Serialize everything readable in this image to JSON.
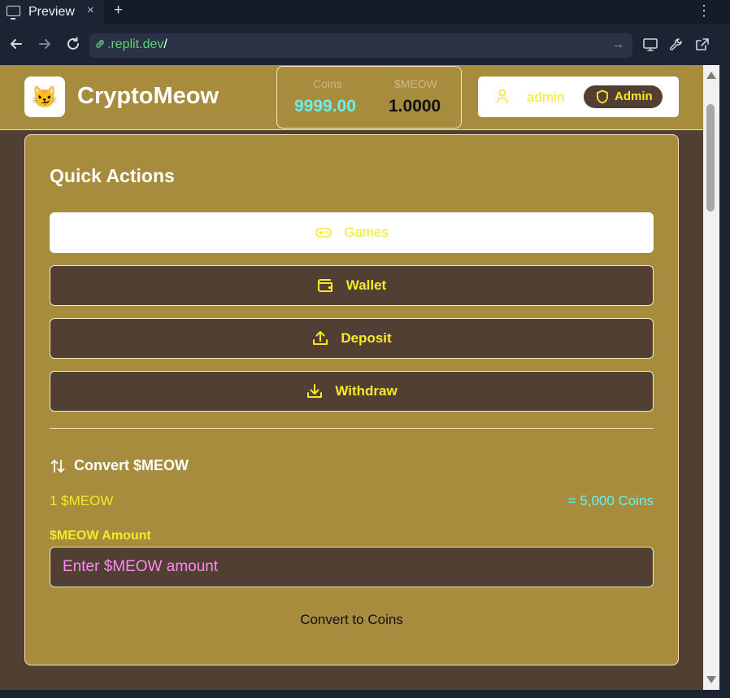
{
  "browser": {
    "tab_title": "Preview",
    "tab_close": "×",
    "new_tab": "+",
    "menu": "⋮",
    "url_host": ".replit.dev",
    "url_path": "/"
  },
  "header": {
    "logo_emoji": "😼",
    "brand": "CryptoMeow",
    "balances": {
      "coins_label": "Coins",
      "coins_value": "9999.00",
      "meow_label": "$MEOW",
      "meow_value": "1.0000"
    },
    "user": {
      "name": "admin",
      "badge": "Admin"
    }
  },
  "quick_actions": {
    "title": "Quick Actions",
    "buttons": [
      {
        "label": "Games",
        "icon": "gamepad-icon"
      },
      {
        "label": "Wallet",
        "icon": "wallet-icon"
      },
      {
        "label": "Deposit",
        "icon": "upload-icon"
      },
      {
        "label": "Withdraw",
        "icon": "download-icon"
      }
    ]
  },
  "convert": {
    "title": "Convert $MEOW",
    "rate_from": "1 $MEOW",
    "rate_to": "= 5,000 Coins",
    "field_label": "$MEOW Amount",
    "placeholder": "Enter $MEOW amount",
    "value": "",
    "submit_label": "Convert to Coins"
  },
  "colors": {
    "page_bg": "#523f33",
    "card_bg": "#a78c3e",
    "accent_yellow": "#f7e82a",
    "accent_cyan": "#66f1f1",
    "placeholder_pink": "#ff8af0"
  }
}
